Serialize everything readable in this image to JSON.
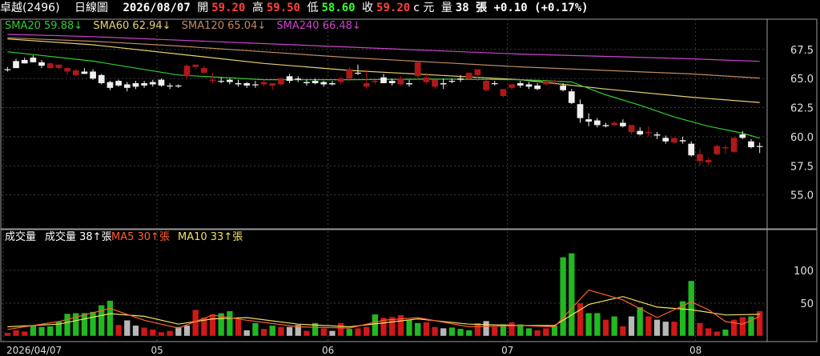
{
  "header": {
    "stock": "卓越(2496)",
    "period": "日線圖",
    "date": "2026/08/07",
    "open_label": "開",
    "open": "59.20",
    "high_label": "高",
    "high": "59.50",
    "low_label": "低",
    "low": "58.60",
    "close_label": "收",
    "close": "59.20",
    "currency": "c 元",
    "volume_label": "量",
    "volume": "38 張",
    "change": "+0.10 (+0.17%)"
  },
  "colors": {
    "up": "#b01818",
    "down": "#f0f0f0",
    "sma20": "#33cc33",
    "sma60": "#e8d070",
    "sma120": "#c08a60",
    "sma240": "#cc44cc",
    "ma5": "#ff6030",
    "ma10": "#f0e060",
    "vol_up": "#d01818",
    "vol_down": "#22b822",
    "vol_flat": "#b8b8b8"
  },
  "chart_data": [
    {
      "type": "candlestick",
      "legend": [
        {
          "label": "SMA20",
          "value": "59.88",
          "arrow": "↓",
          "color": "#33cc33"
        },
        {
          "label": "SMA60",
          "value": "62.94",
          "arrow": "↓",
          "color": "#e8d070"
        },
        {
          "label": "SMA120",
          "value": "65.04",
          "arrow": "↓",
          "color": "#c08a60"
        },
        {
          "label": "SMA240",
          "value": "66.48",
          "arrow": "↓",
          "color": "#cc44cc"
        }
      ],
      "ylim": [
        52.5,
        69
      ],
      "yticks": [
        "67.5",
        "65.0",
        "62.5",
        "60.0",
        "57.5",
        "55.0"
      ],
      "xticks": [
        {
          "label": "2026/04/07",
          "index": 0
        },
        {
          "label": "05",
          "index": 18
        },
        {
          "label": "06",
          "index": 38
        },
        {
          "label": "07",
          "index": 59
        },
        {
          "label": "08",
          "index": 81
        }
      ],
      "candles": [
        [
          65.8,
          66.0,
          65.6,
          65.8
        ],
        [
          66.5,
          66.7,
          65.9,
          65.9
        ],
        [
          66.6,
          66.8,
          66.3,
          66.3
        ],
        [
          66.8,
          67.0,
          66.4,
          66.4
        ],
        [
          66.4,
          66.6,
          65.9,
          66.1
        ],
        [
          65.9,
          66.4,
          65.8,
          66.3
        ],
        [
          65.9,
          66.2,
          65.8,
          66.2
        ],
        [
          65.6,
          66.0,
          65.3,
          65.9
        ],
        [
          65.3,
          65.8,
          65.2,
          65.7
        ],
        [
          65.6,
          65.9,
          65.4,
          65.4
        ],
        [
          65.6,
          65.8,
          64.9,
          65.0
        ],
        [
          65.3,
          65.4,
          64.5,
          64.6
        ],
        [
          64.7,
          64.8,
          64.0,
          64.2
        ],
        [
          64.8,
          64.9,
          64.3,
          64.4
        ],
        [
          64.5,
          64.7,
          63.9,
          64.2
        ],
        [
          64.6,
          64.8,
          64.1,
          64.3
        ],
        [
          64.6,
          64.8,
          64.2,
          64.4
        ],
        [
          64.7,
          64.9,
          64.3,
          64.5
        ],
        [
          64.9,
          65.0,
          64.3,
          64.4
        ],
        [
          64.4,
          64.6,
          64.1,
          64.4
        ],
        [
          64.4,
          64.5,
          64.2,
          64.4
        ],
        [
          65.2,
          66.2,
          65.0,
          66.1
        ],
        [
          66.0,
          66.2,
          65.8,
          66.2
        ],
        [
          65.5,
          66.1,
          65.4,
          65.9
        ],
        [
          64.8,
          65.5,
          64.6,
          64.9
        ],
        [
          64.8,
          65.1,
          64.6,
          64.8
        ],
        [
          64.9,
          65.0,
          64.5,
          64.7
        ],
        [
          64.6,
          64.9,
          64.3,
          64.5
        ],
        [
          64.6,
          64.7,
          64.2,
          64.4
        ],
        [
          64.5,
          64.8,
          64.2,
          64.5
        ],
        [
          64.5,
          64.9,
          64.3,
          64.7
        ],
        [
          64.4,
          64.6,
          64.0,
          64.6
        ],
        [
          64.5,
          65.1,
          64.4,
          65.0
        ],
        [
          65.2,
          65.4,
          64.6,
          64.8
        ],
        [
          65.0,
          65.2,
          64.7,
          64.9
        ],
        [
          64.7,
          64.9,
          64.4,
          64.6
        ],
        [
          64.8,
          65.0,
          64.5,
          64.6
        ],
        [
          64.7,
          64.8,
          64.3,
          64.5
        ],
        [
          64.6,
          64.8,
          64.4,
          64.5
        ],
        [
          64.7,
          65.2,
          64.5,
          65.0
        ],
        [
          65.0,
          66.0,
          64.8,
          65.8
        ],
        [
          65.5,
          66.2,
          65.3,
          65.5
        ],
        [
          64.3,
          65.8,
          64.1,
          64.6
        ],
        [
          64.7,
          64.9,
          64.5,
          64.8
        ],
        [
          65.1,
          65.4,
          64.8,
          64.6
        ],
        [
          64.8,
          65.0,
          64.4,
          64.6
        ],
        [
          64.5,
          65.2,
          64.4,
          65.0
        ],
        [
          64.6,
          64.9,
          64.3,
          64.5
        ],
        [
          65.2,
          66.5,
          64.9,
          66.4
        ],
        [
          64.7,
          65.5,
          64.5,
          65.1
        ],
        [
          64.3,
          65.0,
          64.1,
          64.9
        ],
        [
          64.6,
          65.0,
          64.1,
          64.5
        ],
        [
          64.8,
          65.0,
          64.6,
          64.8
        ],
        [
          65.0,
          65.3,
          64.7,
          64.9
        ],
        [
          65.0,
          65.5,
          64.9,
          65.5
        ],
        [
          65.3,
          65.6,
          64.8,
          65.8
        ],
        [
          64.0,
          64.9,
          63.9,
          64.8
        ],
        [
          64.6,
          64.8,
          64.4,
          64.6
        ],
        [
          63.5,
          64.1,
          63.4,
          64.1
        ],
        [
          64.2,
          64.5,
          64.0,
          64.5
        ],
        [
          64.6,
          64.8,
          64.2,
          64.4
        ],
        [
          64.5,
          64.7,
          64.1,
          64.3
        ],
        [
          64.4,
          64.6,
          64.0,
          64.1
        ],
        [
          64.5,
          64.8,
          64.4,
          64.8
        ],
        [
          64.7,
          64.9,
          64.5,
          64.8
        ],
        [
          64.4,
          64.6,
          63.9,
          64.0
        ],
        [
          63.9,
          64.1,
          62.8,
          62.9
        ],
        [
          62.8,
          63.2,
          61.2,
          61.6
        ],
        [
          61.5,
          62.0,
          60.9,
          61.3
        ],
        [
          61.4,
          61.6,
          60.8,
          61.0
        ],
        [
          61.0,
          61.2,
          60.8,
          60.9
        ],
        [
          61.0,
          61.3,
          60.9,
          61.2
        ],
        [
          61.2,
          61.5,
          60.8,
          60.9
        ],
        [
          60.4,
          61.0,
          60.2,
          61.0
        ],
        [
          60.5,
          60.8,
          60.1,
          60.2
        ],
        [
          60.3,
          60.9,
          60.0,
          60.4
        ],
        [
          60.2,
          60.4,
          59.8,
          60.1
        ],
        [
          59.9,
          60.1,
          59.4,
          59.6
        ],
        [
          59.5,
          59.9,
          59.4,
          59.9
        ],
        [
          59.7,
          60.0,
          59.4,
          59.6
        ],
        [
          59.4,
          59.6,
          58.3,
          58.4
        ],
        [
          57.9,
          59.0,
          57.5,
          58.5
        ],
        [
          57.8,
          58.2,
          57.6,
          58.0
        ],
        [
          58.5,
          59.3,
          58.4,
          59.2
        ],
        [
          59.0,
          59.3,
          58.5,
          59.1
        ],
        [
          58.7,
          60.0,
          58.6,
          59.9
        ],
        [
          60.2,
          60.5,
          59.8,
          59.9
        ],
        [
          59.6,
          59.8,
          59.0,
          59.1
        ],
        [
          59.2,
          59.5,
          58.6,
          59.2
        ]
      ],
      "sma20": [
        [
          0,
          67.3
        ],
        [
          10,
          66.5
        ],
        [
          20,
          65.3
        ],
        [
          30,
          64.9
        ],
        [
          40,
          64.9
        ],
        [
          50,
          64.95
        ],
        [
          60,
          64.9
        ],
        [
          62,
          64.85
        ],
        [
          66,
          64.7
        ],
        [
          70,
          63.6
        ],
        [
          74,
          62.7
        ],
        [
          78,
          61.7
        ],
        [
          82,
          60.9
        ],
        [
          86,
          60.3
        ],
        [
          88,
          59.88
        ]
      ],
      "sma60": [
        [
          0,
          68.4
        ],
        [
          10,
          67.9
        ],
        [
          20,
          67.1
        ],
        [
          30,
          66.3
        ],
        [
          40,
          65.7
        ],
        [
          50,
          65.3
        ],
        [
          60,
          64.9
        ],
        [
          70,
          64.1
        ],
        [
          80,
          63.4
        ],
        [
          88,
          62.94
        ]
      ],
      "sma120": [
        [
          0,
          68.5
        ],
        [
          10,
          68.2
        ],
        [
          20,
          67.8
        ],
        [
          30,
          67.3
        ],
        [
          40,
          66.8
        ],
        [
          50,
          66.4
        ],
        [
          60,
          66.0
        ],
        [
          70,
          65.7
        ],
        [
          80,
          65.4
        ],
        [
          88,
          65.04
        ]
      ],
      "sma240": [
        [
          0,
          68.8
        ],
        [
          10,
          68.6
        ],
        [
          20,
          68.3
        ],
        [
          30,
          68.0
        ],
        [
          40,
          67.7
        ],
        [
          50,
          67.4
        ],
        [
          60,
          67.1
        ],
        [
          70,
          66.9
        ],
        [
          80,
          66.7
        ],
        [
          88,
          66.48
        ]
      ]
    },
    {
      "type": "bar",
      "title": "成交量",
      "legend": [
        {
          "label": "成交量",
          "value": "38",
          "arrow": "↑",
          "unit": "張",
          "color": "#ffffff"
        },
        {
          "label": "MA5",
          "value": "30",
          "arrow": "↑",
          "unit": "張",
          "color": "#ff6030"
        },
        {
          "label": "MA10",
          "value": "33",
          "arrow": "↑",
          "unit": "張",
          "color": "#f0e060"
        }
      ],
      "ylim": [
        0,
        140
      ],
      "yticks": [
        "100",
        "50"
      ],
      "volumes": [
        5,
        9,
        7,
        16,
        14,
        15,
        22,
        34,
        35,
        35,
        37,
        47,
        54,
        17,
        24,
        16,
        13,
        10,
        6,
        8,
        14,
        16,
        40,
        28,
        33,
        35,
        38,
        26,
        9,
        20,
        11,
        16,
        14,
        14,
        17,
        8,
        20,
        12,
        8,
        20,
        11,
        12,
        14,
        33,
        28,
        29,
        32,
        25,
        20,
        21,
        14,
        12,
        13,
        11,
        9,
        20,
        23,
        14,
        18,
        21,
        18,
        12,
        9,
        12,
        16,
        120,
        126,
        50,
        35,
        35,
        25,
        30,
        15,
        30,
        44,
        30,
        25,
        22,
        22,
        53,
        84,
        20,
        12,
        7,
        10,
        25,
        29,
        30,
        38
      ],
      "volume_colors": [
        "u",
        "u",
        "u",
        "d",
        "d",
        "d",
        "d",
        "d",
        "d",
        "d",
        "d",
        "d",
        "d",
        "u",
        "f",
        "f",
        "u",
        "u",
        "u",
        "u",
        "f",
        "f",
        "u",
        "u",
        "u",
        "d",
        "d",
        "u",
        "f",
        "d",
        "u",
        "d",
        "u",
        "f",
        "f",
        "u",
        "d",
        "u",
        "f",
        "u",
        "d",
        "u",
        "u",
        "d",
        "u",
        "u",
        "u",
        "d",
        "d",
        "u",
        "u",
        "f",
        "d",
        "d",
        "d",
        "u",
        "f",
        "u",
        "d",
        "u",
        "d",
        "d",
        "u",
        "u",
        "d",
        "d",
        "d",
        "u",
        "d",
        "d",
        "u",
        "d",
        "u",
        "f",
        "d",
        "u",
        "f",
        "f",
        "u",
        "d",
        "d",
        "u",
        "u",
        "u",
        "d",
        "u",
        "u",
        "d",
        "u"
      ],
      "ma5": [
        [
          0,
          10
        ],
        [
          6,
          22
        ],
        [
          12,
          42
        ],
        [
          16,
          24
        ],
        [
          20,
          12
        ],
        [
          24,
          32
        ],
        [
          28,
          24
        ],
        [
          34,
          14
        ],
        [
          40,
          12
        ],
        [
          44,
          24
        ],
        [
          48,
          28
        ],
        [
          54,
          14
        ],
        [
          60,
          16
        ],
        [
          64,
          14
        ],
        [
          68,
          70
        ],
        [
          72,
          55
        ],
        [
          76,
          28
        ],
        [
          80,
          52
        ],
        [
          82,
          40
        ],
        [
          84,
          22
        ],
        [
          86,
          18
        ],
        [
          88,
          30
        ]
      ],
      "ma10": [
        [
          0,
          14
        ],
        [
          6,
          18
        ],
        [
          12,
          34
        ],
        [
          16,
          30
        ],
        [
          20,
          18
        ],
        [
          24,
          26
        ],
        [
          28,
          28
        ],
        [
          34,
          18
        ],
        [
          40,
          14
        ],
        [
          44,
          20
        ],
        [
          48,
          26
        ],
        [
          54,
          18
        ],
        [
          60,
          16
        ],
        [
          64,
          16
        ],
        [
          68,
          48
        ],
        [
          72,
          60
        ],
        [
          76,
          44
        ],
        [
          80,
          40
        ],
        [
          84,
          32
        ],
        [
          88,
          33
        ]
      ]
    }
  ]
}
